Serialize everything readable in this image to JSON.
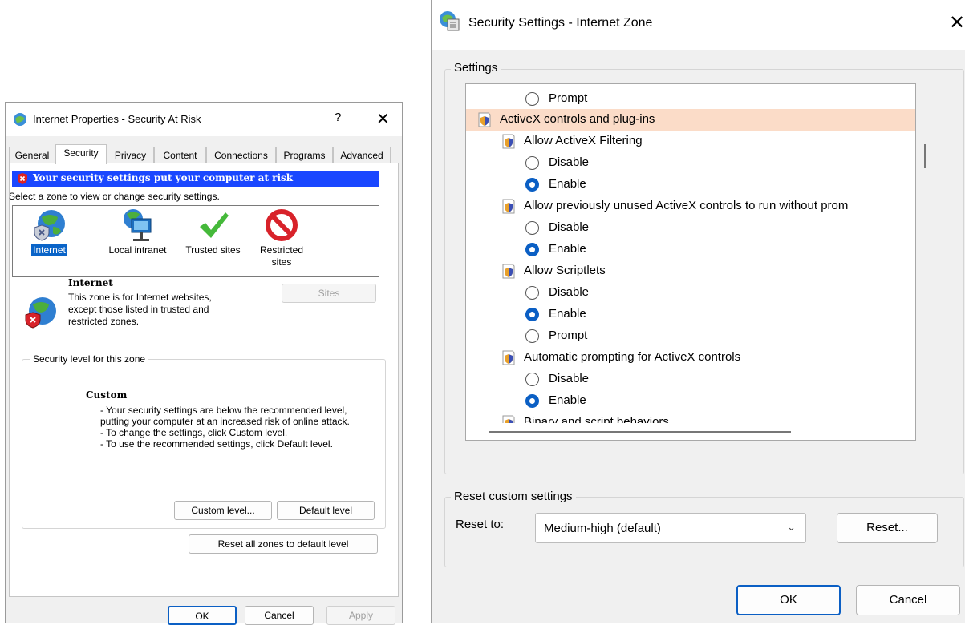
{
  "internet_properties": {
    "title": "Internet Properties - Security At Risk",
    "help_glyph": "?",
    "close_glyph": "✕",
    "tabs": [
      "General",
      "Security",
      "Privacy",
      "Content",
      "Connections",
      "Programs",
      "Advanced"
    ],
    "active_tab": "Security",
    "risk_banner": "Your security settings put your computer at risk",
    "select_zone_text": "Select a zone to view or change security settings.",
    "zones": [
      {
        "label": "Internet",
        "icon": "globe-at-risk-icon",
        "selected": true
      },
      {
        "label": "Local intranet",
        "icon": "intranet-monitor-icon",
        "selected": false
      },
      {
        "label": "Trusted sites",
        "icon": "checkmark-icon",
        "selected": false
      },
      {
        "label": "Restricted sites",
        "icon": "no-entry-icon",
        "selected": false
      }
    ],
    "zone_name": "Internet",
    "zone_description": "This zone is for Internet websites, except those listed in trusted and restricted zones.",
    "sites_button": "Sites",
    "security_level_group": "Security level for this zone",
    "level_name": "Custom",
    "level_lines": [
      "- Your security settings are below the recommended level, putting your computer at an increased risk of online attack.",
      "- To change the settings, click Custom level.",
      "- To use the recommended settings, click Default level."
    ],
    "custom_level_button": "Custom level...",
    "default_level_button": "Default level",
    "reset_all_button": "Reset all zones to default level",
    "ok_button": "OK",
    "cancel_button": "Cancel",
    "apply_button": "Apply",
    "colors": {
      "risk_banner": "#1a47ff",
      "selection": "#0a64c8"
    }
  },
  "security_settings": {
    "title": "Security Settings - Internet Zone",
    "close_glyph": "✕",
    "settings_group": "Settings",
    "rows": [
      {
        "type": "option",
        "label": "Prompt",
        "checked": false
      },
      {
        "type": "category",
        "label": "ActiveX controls and plug-ins"
      },
      {
        "type": "setting",
        "label": "Allow ActiveX Filtering"
      },
      {
        "type": "option",
        "label": "Disable",
        "checked": false
      },
      {
        "type": "option",
        "label": "Enable",
        "checked": true
      },
      {
        "type": "setting",
        "label": "Allow previously unused ActiveX controls to run without prom"
      },
      {
        "type": "option",
        "label": "Disable",
        "checked": false
      },
      {
        "type": "option",
        "label": "Enable",
        "checked": true
      },
      {
        "type": "setting",
        "label": "Allow Scriptlets"
      },
      {
        "type": "option",
        "label": "Disable",
        "checked": false
      },
      {
        "type": "option",
        "label": "Enable",
        "checked": true
      },
      {
        "type": "option",
        "label": "Prompt",
        "checked": false
      },
      {
        "type": "setting",
        "label": "Automatic prompting for ActiveX controls"
      },
      {
        "type": "option",
        "label": "Disable",
        "checked": false
      },
      {
        "type": "option",
        "label": "Enable",
        "checked": true
      },
      {
        "type": "setting",
        "label": "Binary and script behaviors"
      }
    ],
    "reset_group": "Reset custom settings",
    "reset_to_label": "Reset to:",
    "reset_to_value": "Medium-high (default)",
    "reset_button": "Reset...",
    "ok_button": "OK",
    "cancel_button": "Cancel",
    "colors": {
      "category_highlight": "#fbdcc8",
      "accent": "#0b5fc4"
    }
  }
}
